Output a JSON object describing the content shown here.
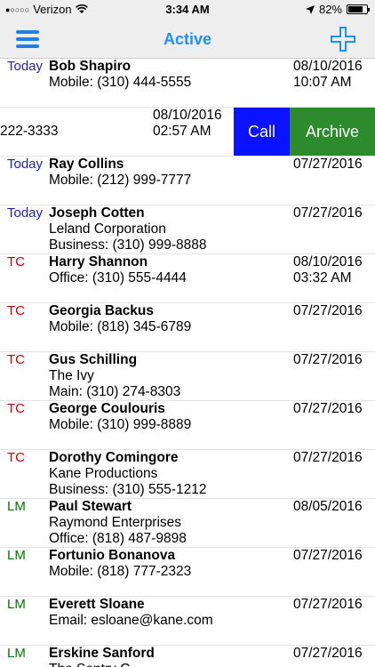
{
  "status_bar": {
    "carrier": "Verizon",
    "signal_dots": "●○○○○",
    "time": "3:34 AM",
    "battery_percent": "82%",
    "battery_level": 0.82
  },
  "nav": {
    "title": "Active"
  },
  "swiped_row": {
    "phone_fragment": "222-3333",
    "date": "08/10/2016",
    "time": "02:57 AM",
    "call_label": "Call",
    "archive_label": "Archive"
  },
  "rows": [
    {
      "tag": "Today",
      "name": "Bob Shapiro",
      "company": "",
      "phone": "Mobile: (310) 444-5555",
      "date": "08/10/2016",
      "time": "10:07 AM"
    },
    {
      "tag": "Today",
      "name": "Ray Collins",
      "company": "",
      "phone": "Mobile: (212) 999-7777",
      "date": "07/27/2016",
      "time": ""
    },
    {
      "tag": "Today",
      "name": "Joseph Cotten",
      "company": "Leland Corporation",
      "phone": "Business: (310) 999-8888",
      "date": "07/27/2016",
      "time": ""
    },
    {
      "tag": "TC",
      "name": "Harry Shannon",
      "company": "",
      "phone": "Office: (310) 555-4444",
      "date": "08/10/2016",
      "time": "03:32 AM"
    },
    {
      "tag": "TC",
      "name": "Georgia Backus",
      "company": "",
      "phone": "Mobile: (818) 345-6789",
      "date": "07/27/2016",
      "time": ""
    },
    {
      "tag": "TC",
      "name": "Gus Schilling",
      "company": "The Ivy",
      "phone": "Main: (310) 274-8303",
      "date": "07/27/2016",
      "time": ""
    },
    {
      "tag": "TC",
      "name": "George Coulouris",
      "company": "",
      "phone": "Mobile: (310) 999-8889",
      "date": "07/27/2016",
      "time": ""
    },
    {
      "tag": "TC",
      "name": "Dorothy Comingore",
      "company": "Kane Productions",
      "phone": "Business: (310) 555-1212",
      "date": "07/27/2016",
      "time": ""
    },
    {
      "tag": "LM",
      "name": "Paul Stewart",
      "company": "Raymond Enterprises",
      "phone": "Office: (818) 487-9898",
      "date": "08/05/2016",
      "time": ""
    },
    {
      "tag": "LM",
      "name": "Fortunio Bonanova",
      "company": "",
      "phone": "Mobile: (818) 777-2323",
      "date": "07/27/2016",
      "time": ""
    },
    {
      "tag": "LM",
      "name": "Everett Sloane",
      "company": "",
      "phone": "Email: esloane@kane.com",
      "date": "07/27/2016",
      "time": ""
    },
    {
      "tag": "LM",
      "name": "Erskine Sanford",
      "company": "The Sentry C...",
      "phone": "",
      "date": "07/27/2016",
      "time": ""
    }
  ],
  "colors": {
    "nav_title": "#1e8fff",
    "tag_today": "#2222aa",
    "tag_tc": "#cc0000",
    "tag_lm": "#007a00",
    "call": "#0a12ff",
    "archive": "#2d8a2d"
  }
}
